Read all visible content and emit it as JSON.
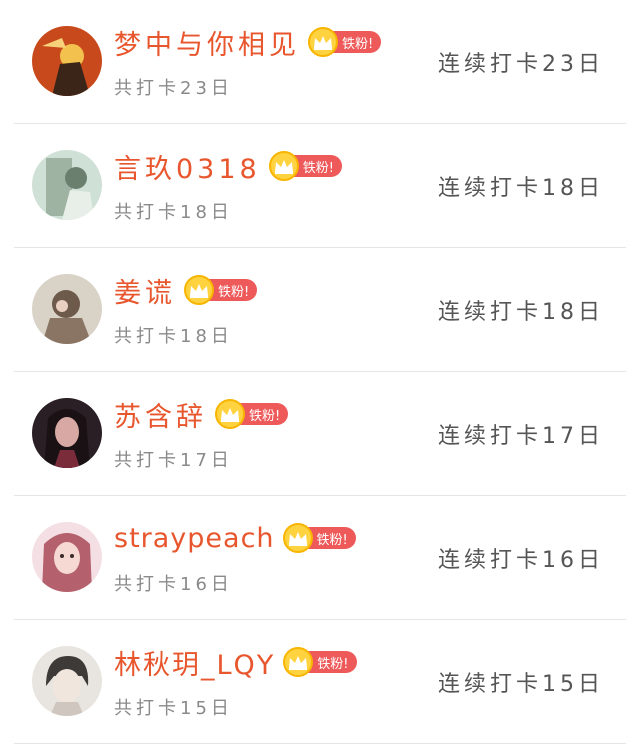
{
  "badge_label": "铁粉!",
  "colors": {
    "name": "#e8562d",
    "badge_pill": "#ee5a5a",
    "crown": "#ffd23f",
    "muted": "#8a8a8a",
    "streak": "#555555",
    "divider": "#e6e6e6"
  },
  "members": [
    {
      "name": "梦中与你相见",
      "total": "共打卡23日",
      "streak": "连续打卡23日",
      "avatar_icon": "avatar-image",
      "avatar_bg": "#c84a1c",
      "avatar_fg": "#f2c14e"
    },
    {
      "name": "言玖0318",
      "total": "共打卡18日",
      "streak": "连续打卡18日",
      "avatar_icon": "avatar-image",
      "avatar_bg": "#cfe0d6",
      "avatar_fg": "#6b7f6e"
    },
    {
      "name": "姜谎",
      "total": "共打卡18日",
      "streak": "连续打卡18日",
      "avatar_icon": "avatar-image",
      "avatar_bg": "#d9d2c6",
      "avatar_fg": "#6e5a4b"
    },
    {
      "name": "苏含辞",
      "total": "共打卡17日",
      "streak": "连续打卡17日",
      "avatar_icon": "avatar-image",
      "avatar_bg": "#2a1f24",
      "avatar_fg": "#d8a9a4"
    },
    {
      "name": "straypeach",
      "total": "共打卡16日",
      "streak": "连续打卡16日",
      "avatar_icon": "avatar-image",
      "avatar_bg": "#f4dfe4",
      "avatar_fg": "#b4616d"
    },
    {
      "name": "林秋玥_LQY",
      "total": "共打卡15日",
      "streak": "连续打卡15日",
      "avatar_icon": "avatar-image",
      "avatar_bg": "#e8e4df",
      "avatar_fg": "#3d3a38"
    }
  ]
}
